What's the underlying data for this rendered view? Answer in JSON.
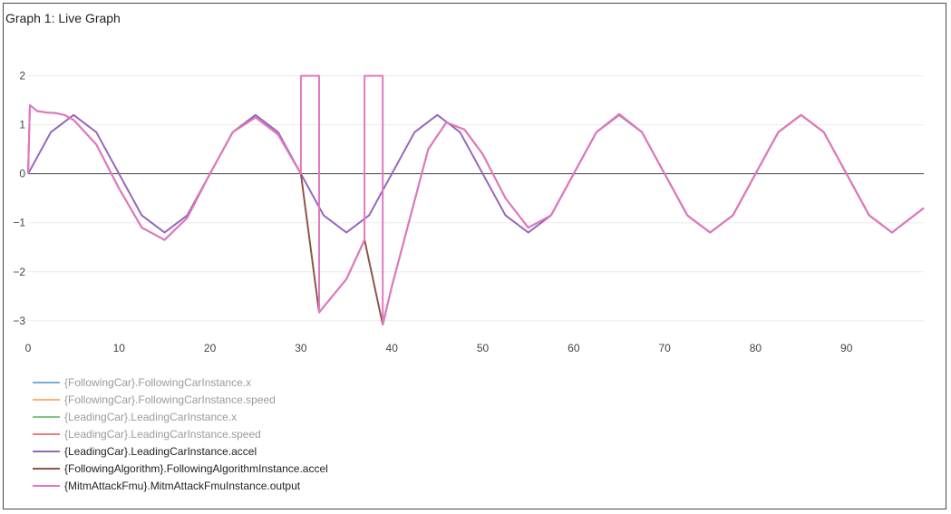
{
  "graph": {
    "title": "Graph 1: Live Graph"
  },
  "chart_data": {
    "type": "line",
    "xlim": [
      0,
      98.5
    ],
    "ylim": [
      -3.3,
      2.4
    ],
    "x_ticks": [
      0,
      10,
      20,
      30,
      40,
      50,
      60,
      70,
      80,
      90
    ],
    "y_ticks": [
      2,
      1,
      0,
      -1,
      -2,
      -3
    ],
    "y_tick_labels": [
      "2",
      "1",
      "0",
      "−1",
      "−2",
      "−3"
    ],
    "grid": true,
    "legend_position": "bottom-left",
    "series": [
      {
        "name": "{FollowingCar}.FollowingCarInstance.x",
        "color": "#1f77b4",
        "visible": false,
        "x": [],
        "y": []
      },
      {
        "name": "{FollowingCar}.FollowingCarInstance.speed",
        "color": "#ff7f0e",
        "visible": false,
        "x": [],
        "y": []
      },
      {
        "name": "{LeadingCar}.LeadingCarInstance.x",
        "color": "#2ca02c",
        "visible": false,
        "x": [],
        "y": []
      },
      {
        "name": "{LeadingCar}.LeadingCarInstance.speed",
        "color": "#d62728",
        "visible": false,
        "x": [],
        "y": []
      },
      {
        "name": "{LeadingCar}.LeadingCarInstance.accel",
        "color": "#9467bd",
        "visible": true,
        "x": [
          0,
          2.5,
          5,
          7.5,
          10,
          12.5,
          15,
          17.5,
          20,
          22.5,
          25,
          27.5,
          30,
          32.5,
          35,
          37.5,
          40,
          42.5,
          45,
          47.5,
          50,
          52.5,
          55,
          57.5,
          60,
          62.5,
          65,
          67.5,
          70,
          72.5,
          75,
          77.5,
          80,
          82.5,
          85,
          87.5,
          90,
          92.5,
          95,
          98.5
        ],
        "y": [
          0,
          0.85,
          1.2,
          0.85,
          0,
          -0.85,
          -1.2,
          -0.85,
          0,
          0.85,
          1.2,
          0.85,
          0,
          -0.85,
          -1.2,
          -0.85,
          0,
          0.85,
          1.2,
          0.85,
          0,
          -0.85,
          -1.2,
          -0.85,
          0,
          0.85,
          1.2,
          0.85,
          0,
          -0.85,
          -1.2,
          -0.85,
          0,
          0.85,
          1.2,
          0.85,
          0,
          -0.85,
          -1.2,
          -0.7
        ]
      },
      {
        "name": "{FollowingAlgorithm}.FollowingAlgorithmInstance.accel",
        "color": "#8c564b",
        "visible": true,
        "x": [
          0,
          0.2,
          1,
          2,
          3,
          4,
          5,
          7.5,
          10,
          12.5,
          15,
          17.5,
          20,
          22.5,
          25,
          27.5,
          30,
          32,
          35,
          37,
          39,
          40,
          42,
          44,
          46,
          48,
          50,
          52.5,
          55,
          57.5,
          60,
          62.5,
          65,
          67.5,
          70,
          72.5,
          75,
          77.5,
          80,
          82.5,
          85,
          87.5,
          90,
          92.5,
          95,
          98.5
        ],
        "y": [
          0,
          1.4,
          1.28,
          1.25,
          1.24,
          1.2,
          1.1,
          0.6,
          -0.3,
          -1.1,
          -1.35,
          -0.9,
          0,
          0.85,
          1.15,
          0.8,
          0,
          -2.83,
          -2.15,
          -1.35,
          -3.08,
          -2.3,
          -0.9,
          0.5,
          1.05,
          0.9,
          0.4,
          -0.5,
          -1.1,
          -0.85,
          0,
          0.85,
          1.22,
          0.85,
          0,
          -0.85,
          -1.2,
          -0.85,
          0,
          0.85,
          1.2,
          0.85,
          0,
          -0.85,
          -1.2,
          -0.7
        ]
      },
      {
        "name": "{MitmAttackFmu}.MitmAttackFmuInstance.output",
        "color": "#e377c2",
        "visible": true,
        "x": [
          0,
          0.2,
          1,
          2,
          3,
          4,
          5,
          7.5,
          10,
          12.5,
          15,
          17.5,
          20,
          22.5,
          25,
          27.5,
          30,
          30,
          32,
          32,
          35,
          37,
          37,
          39,
          39,
          40,
          42,
          44,
          46,
          48,
          50,
          52.5,
          55,
          57.5,
          60,
          62.5,
          65,
          67.5,
          70,
          72.5,
          75,
          77.5,
          80,
          82.5,
          85,
          87.5,
          90,
          92.5,
          95,
          98.5
        ],
        "y": [
          0,
          1.4,
          1.28,
          1.25,
          1.24,
          1.2,
          1.1,
          0.6,
          -0.3,
          -1.1,
          -1.35,
          -0.9,
          0,
          0.85,
          1.15,
          0.8,
          0,
          2,
          2,
          -2.83,
          -2.15,
          -1.35,
          2,
          2,
          -3.08,
          -2.3,
          -0.9,
          0.5,
          1.05,
          0.9,
          0.4,
          -0.5,
          -1.1,
          -0.85,
          0,
          0.85,
          1.22,
          0.85,
          0,
          -0.85,
          -1.2,
          -0.85,
          0,
          0.85,
          1.2,
          0.85,
          0,
          -0.85,
          -1.2,
          -0.7
        ]
      }
    ]
  }
}
